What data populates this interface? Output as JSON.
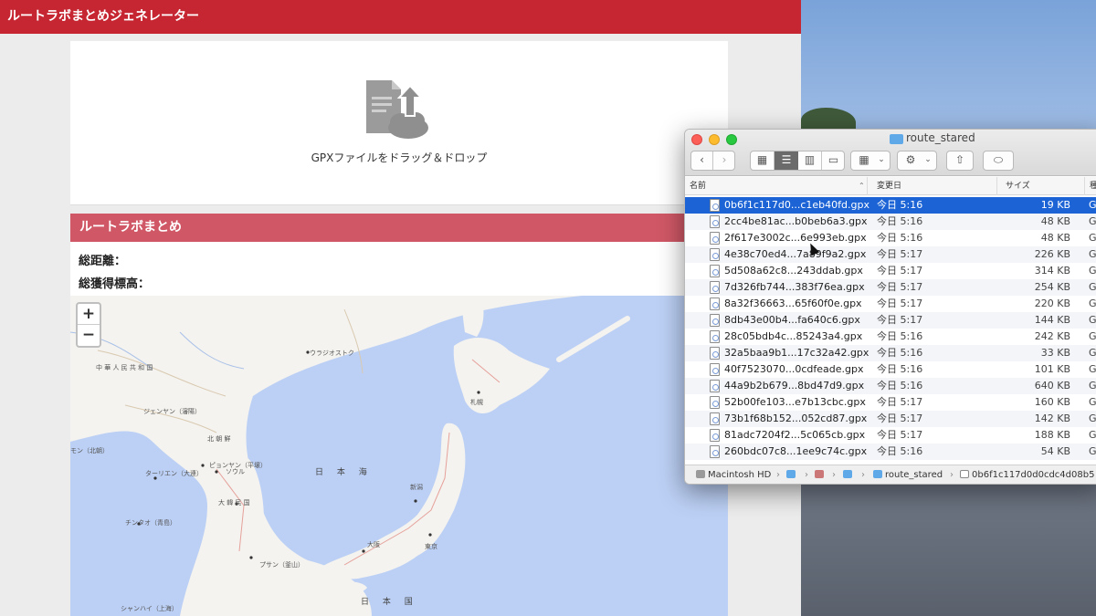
{
  "app": {
    "title": "ルートラボまとめジェネレーター",
    "drop_label": "GPXファイルをドラッグ＆ドロップ",
    "summary_title": "ルートラボまとめ",
    "total_distance_label": "総距離：",
    "total_elevation_label": "総獲得標高：",
    "zoom_in": "+",
    "zoom_out": "−",
    "map_labels": [
      "中 華 人 民 共 和 国",
      "ウラジオストク",
      "ジェンヤン（瀋陽）",
      "北 朝 鮮",
      "ピョンヤン（平壌）",
      "ターリエン（大連）",
      "ソウル",
      "チンタオ（青島）",
      "大 韓 民 国",
      "プサン（釜山）",
      "日 本 海",
      "札幌",
      "新潟",
      "東京",
      "大阪",
      "シャンハイ（上海）",
      "日 本 国",
      "モン（北朝）"
    ]
  },
  "finder": {
    "window_title": "route_stared",
    "toolbar": {
      "back": "‹",
      "forward": "›",
      "view_icons": "▦",
      "view_list": "☰",
      "view_columns": "▥",
      "view_gallery": "▭",
      "arrange": "▦",
      "arrange_caret": "⌄",
      "action": "⚙",
      "action_caret": "⌄",
      "share": "⇧",
      "tag": "⬭"
    },
    "columns": {
      "name": "名前",
      "date": "変更日",
      "size": "サイズ",
      "kind": "種"
    },
    "files": [
      {
        "name": "0b6f1c117d0...c1eb40fd.gpx",
        "date": "今日 5:16",
        "size": "19 KB",
        "kind": "GP"
      },
      {
        "name": "2cc4be81ac...b0beb6a3.gpx",
        "date": "今日 5:16",
        "size": "48 KB",
        "kind": "GP"
      },
      {
        "name": "2f617e3002c...6e993eb.gpx",
        "date": "今日 5:16",
        "size": "48 KB",
        "kind": "GP"
      },
      {
        "name": "4e38c70ed4...7a89f9a2.gpx",
        "date": "今日 5:17",
        "size": "226 KB",
        "kind": "GP"
      },
      {
        "name": "5d508a62c8...243ddab.gpx",
        "date": "今日 5:17",
        "size": "314 KB",
        "kind": "GP"
      },
      {
        "name": "7d326fb744...383f76ea.gpx",
        "date": "今日 5:17",
        "size": "254 KB",
        "kind": "GP"
      },
      {
        "name": "8a32f36663...65f60f0e.gpx",
        "date": "今日 5:17",
        "size": "220 KB",
        "kind": "GP"
      },
      {
        "name": "8db43e00b4...fa640c6.gpx",
        "date": "今日 5:17",
        "size": "144 KB",
        "kind": "GP"
      },
      {
        "name": "28c05bdb4c...85243a4.gpx",
        "date": "今日 5:16",
        "size": "242 KB",
        "kind": "GP"
      },
      {
        "name": "32a5baa9b1...17c32a42.gpx",
        "date": "今日 5:16",
        "size": "33 KB",
        "kind": "GP"
      },
      {
        "name": "40f7523070...0cdfeade.gpx",
        "date": "今日 5:16",
        "size": "101 KB",
        "kind": "GP"
      },
      {
        "name": "44a9b2b679...8bd47d9.gpx",
        "date": "今日 5:16",
        "size": "640 KB",
        "kind": "GP"
      },
      {
        "name": "52b00fe103...e7b13cbc.gpx",
        "date": "今日 5:17",
        "size": "160 KB",
        "kind": "GP"
      },
      {
        "name": "73b1f68b152...052cd87.gpx",
        "date": "今日 5:17",
        "size": "142 KB",
        "kind": "GP"
      },
      {
        "name": "81adc7204f2...5c065cb.gpx",
        "date": "今日 5:17",
        "size": "188 KB",
        "kind": "GP"
      },
      {
        "name": "260bdc07c8...1ee9c74c.gpx",
        "date": "今日 5:16",
        "size": "54 KB",
        "kind": "GP"
      }
    ],
    "path": [
      "Macintosh HD",
      "route_stared",
      "0b6f1c117d0d0cdc4d08b5"
    ],
    "selected_index": 0
  },
  "colors": {
    "header_red": "#c62632",
    "summary_red": "#d05866",
    "selection_blue": "#1c64d6",
    "sea": "#bcd0f5"
  }
}
